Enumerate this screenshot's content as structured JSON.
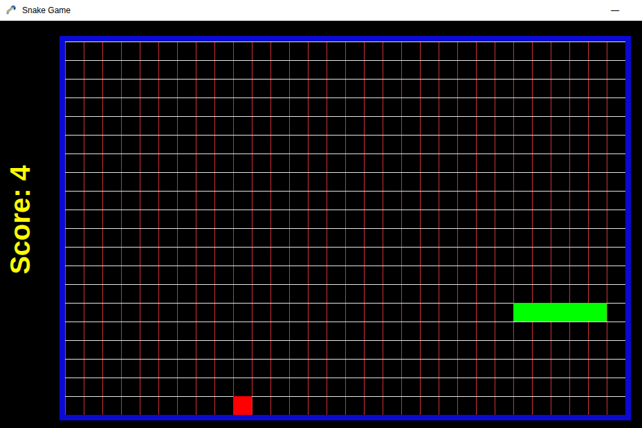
{
  "window": {
    "title": "Snake Game",
    "minimize": "—"
  },
  "score": {
    "label": "Score: 4"
  },
  "board": {
    "columns": 30,
    "rows": 20
  },
  "snake": [
    {
      "col": 24,
      "row": 14
    },
    {
      "col": 25,
      "row": 14
    },
    {
      "col": 26,
      "row": 14
    },
    {
      "col": 27,
      "row": 14
    },
    {
      "col": 28,
      "row": 14
    }
  ],
  "food": {
    "col": 9,
    "row": 19
  }
}
